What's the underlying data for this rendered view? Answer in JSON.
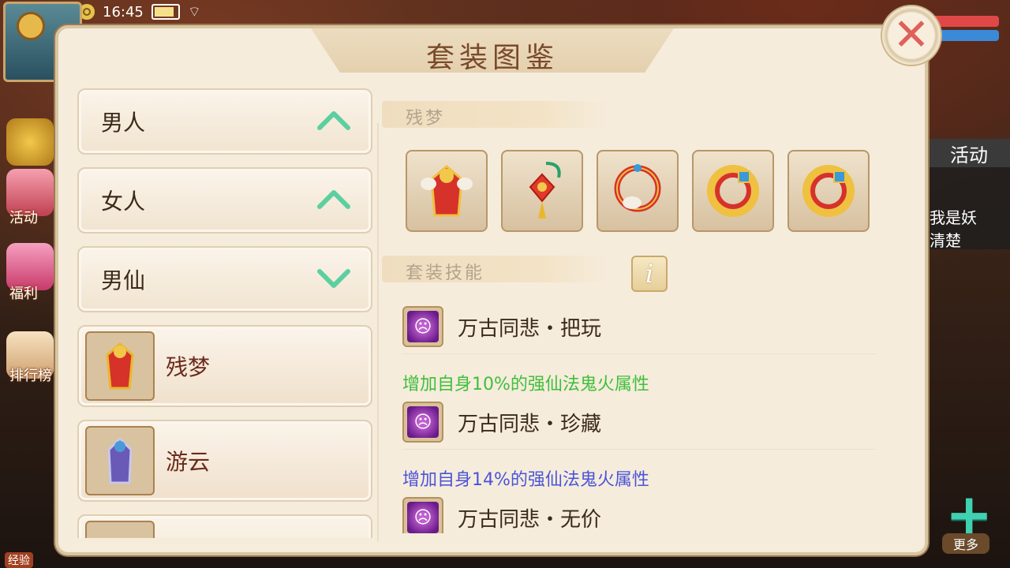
{
  "status_bar": {
    "time": "16:45"
  },
  "background": {
    "left_labels": [
      "活动",
      "福利",
      "排行榜"
    ],
    "exp_label": "经验",
    "right_panel": {
      "header": "活动",
      "text_line1": "我是妖",
      "text_line2": "清楚"
    },
    "more_label": "更多"
  },
  "dialog": {
    "title": "套装图鉴",
    "close_icon": "close-icon",
    "categories": [
      {
        "label": "男人",
        "arrow": "chevron-up-icon"
      },
      {
        "label": "女人",
        "arrow": "chevron-up-icon"
      },
      {
        "label": "男仙",
        "arrow": "chevron-down-icon"
      }
    ],
    "suits": [
      {
        "label": "残梦"
      },
      {
        "label": "游云"
      },
      {
        "label": ""
      }
    ],
    "detail": {
      "set_header": "残梦",
      "items": [
        "robe-icon",
        "pendant-icon",
        "necklace-icon",
        "ring-icon",
        "ring-icon"
      ],
      "skills_header": "套装技能",
      "info_icon": "info-icon",
      "skills": [
        {
          "name": "万古同悲・把玩",
          "desc": "增加自身10%的强仙法鬼火属性",
          "desc_color": "#3fbf3a"
        },
        {
          "name": "万古同悲・珍藏",
          "desc": "增加自身14%的强仙法鬼火属性",
          "desc_color": "#4a55d8"
        },
        {
          "name": "万古同悲・无价",
          "desc": "",
          "desc_color": "#3a2a1a"
        }
      ]
    }
  },
  "colors": {
    "dialog_bg": "#f6ecdc",
    "title": "#7a4a2a",
    "close": "#e0605a",
    "chevron": "#5ccfa0"
  }
}
